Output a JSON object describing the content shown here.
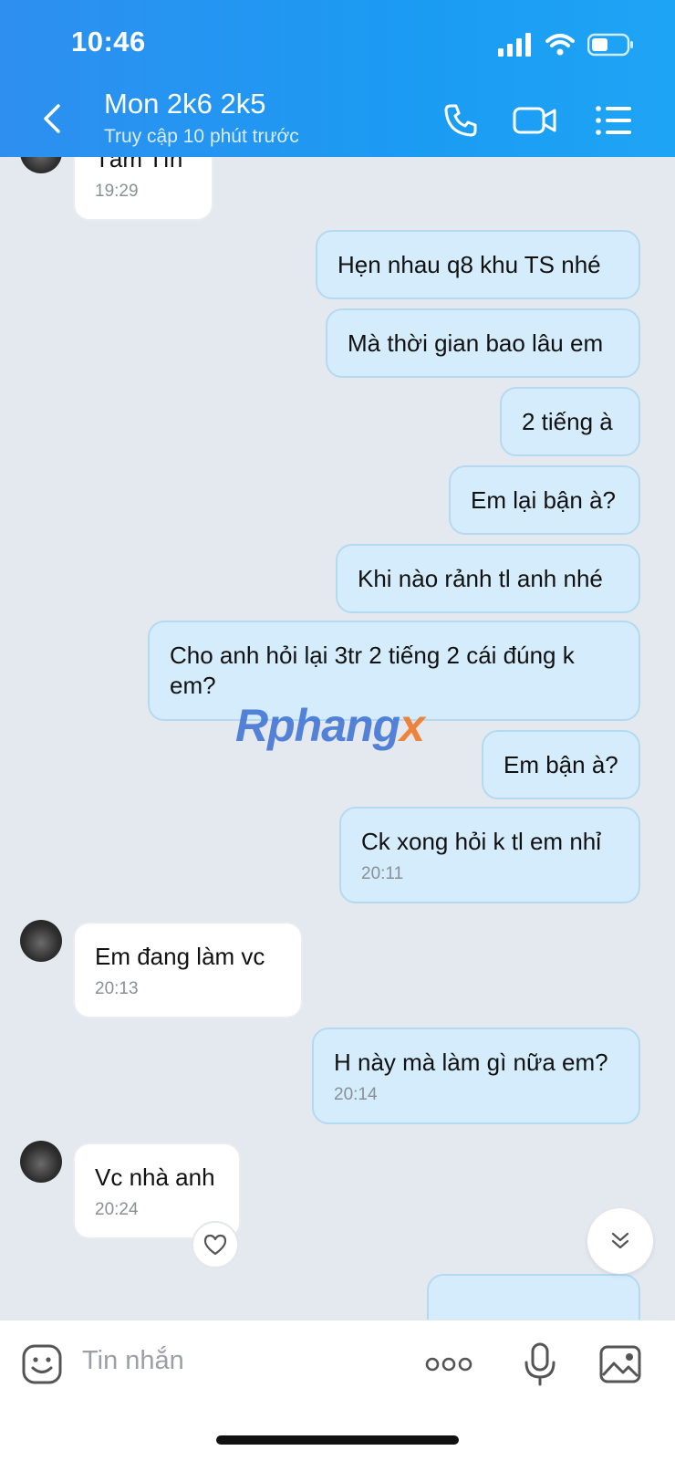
{
  "status_bar": {
    "time": "10:46"
  },
  "header": {
    "title": "Mon 2k6 2k5",
    "subtitle": "Truy cập 10 phút trước"
  },
  "messages": [
    {
      "text": "Tâm Tín",
      "time": "19:29"
    },
    {
      "text": "Hẹn nhau q8 khu TS nhé"
    },
    {
      "text": "Mà thời gian bao lâu em"
    },
    {
      "text": "2 tiếng à"
    },
    {
      "text": "Em lại bận à?"
    },
    {
      "text": "Khi nào rảnh tl anh nhé"
    },
    {
      "text": "Cho anh hỏi lại 3tr 2 tiếng 2 cái đúng k em?"
    },
    {
      "text": "Em bận à?"
    },
    {
      "text": "Ck xong hỏi k tl em nhỉ",
      "time": "20:11"
    },
    {
      "text": "Em đang làm vc",
      "time": "20:13"
    },
    {
      "text": "H này mà làm gì nữa em?",
      "time": "20:14"
    },
    {
      "text": "Vc nhà anh",
      "time": "20:24"
    }
  ],
  "watermark": {
    "main": "Rphang",
    "accent": "x"
  },
  "composer": {
    "placeholder": "Tin nhắn"
  },
  "icons": [
    "back-icon",
    "phone-icon",
    "video-call-icon",
    "menu-icon",
    "heart-icon",
    "chevron-double-down-icon",
    "sticker-icon",
    "more-icon",
    "microphone-icon",
    "image-icon"
  ],
  "colors": {
    "header": "#1b9bf3",
    "outgoing_bubble": "#d4ecfb",
    "incoming_bubble": "#ffffff",
    "chat_bg": "#e4e8ef"
  }
}
